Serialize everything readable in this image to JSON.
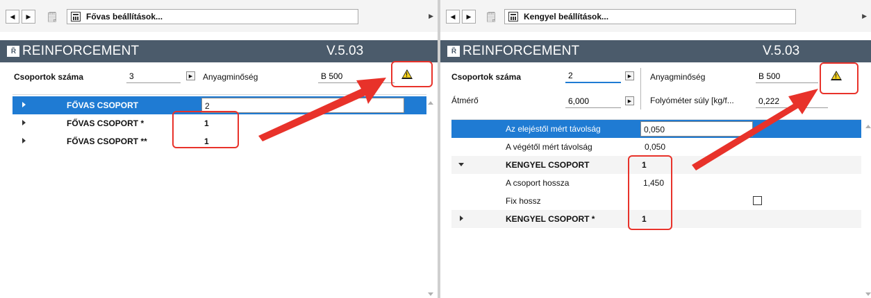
{
  "left": {
    "nav_title": "Fővas beállítások...",
    "brand_name": "REINFORCEMENT",
    "version": "V.5.03",
    "logo_text": "R̃",
    "groups_label": "Csoportok száma",
    "groups_value": "3",
    "material_label": "Anyagminőség",
    "material_value": "B 500",
    "rows": [
      {
        "label": "FŐVAS CSOPORT",
        "value": "2"
      },
      {
        "label": "FŐVAS CSOPORT *",
        "value": "1"
      },
      {
        "label": "FŐVAS CSOPORT **",
        "value": "1"
      }
    ]
  },
  "right": {
    "nav_title": "Kengyel beállítások...",
    "brand_name": "REINFORCEMENT",
    "version": "V.5.03",
    "groups_label": "Csoportok száma",
    "groups_value": "2",
    "material_label": "Anyagminőség",
    "material_value": "B 500",
    "diameter_label": "Átmérő",
    "diameter_value": "6,000",
    "weight_label": "Folyóméter súly [kg/f...",
    "weight_value": "0,222",
    "rows": [
      {
        "label": "Az elejéstől mért távolság",
        "value": "0,050"
      },
      {
        "label": "A végétől mért távolság",
        "value": "0,050"
      },
      {
        "label": "KENGYEL CSOPORT",
        "value": "1"
      },
      {
        "label": "A csoport hossza",
        "value": "1,450"
      },
      {
        "label": "Fix hossz",
        "value": ""
      },
      {
        "label": "KENGYEL CSOPORT *",
        "value": "1"
      }
    ]
  },
  "colors": {
    "brand_bar": "#4b5b6b",
    "selection": "#1f7bd3",
    "highlight": "#e8322a",
    "warning": "#f4d01c"
  },
  "icons": [
    "back-icon",
    "forward-icon",
    "document-icon",
    "calculator-icon",
    "warning-icon",
    "play-icon",
    "expand-triangle-icon",
    "collapse-triangle-icon"
  ]
}
